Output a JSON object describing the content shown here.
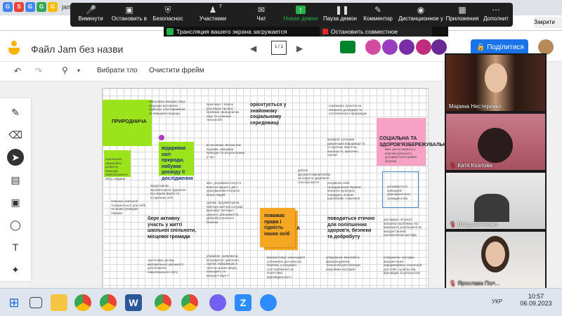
{
  "zoom_controls": {
    "mute": "Вимкнути",
    "stop_video": "Остановить в",
    "security": "Безопаснос",
    "participants": "Участники",
    "participants_count": "7",
    "chat": "Чат",
    "new_demo": "Новая демон",
    "pause_demo": "Пауза демон",
    "comment": "Комментир",
    "remote_control": "Дистанционное у",
    "apps": "Приложения",
    "more": "Дополнит"
  },
  "share_banner": {
    "text": "Трансляция вашего экрана загружается",
    "stop": "Остановить совместное использование"
  },
  "browser": {
    "tab_partial": "jam",
    "close_tab": "Закрити"
  },
  "app": {
    "title": "Файл Jam без назви",
    "page_indicator": "1 / 1",
    "share_button": "Поділитися"
  },
  "toolbar": {
    "select_background": "Вибрати тло",
    "clear_frame": "Очистити фрейм"
  },
  "canvas_notes": {
    "green1": "ПРИРОДНИЧА",
    "green2": "пояснюємо гармонійно розвитку природи, навколишнього світу, людини",
    "green3": "відкриває світ природи, набуває досвіду її дослідження",
    "pink": "СОЦІАЛЬНА ТА ЗДОРОВ'ЯЗБЕРЕЖУВАЛЬНА",
    "pink_small": "вміє застосовувати у власній діяльності, дотримується правил безпеки",
    "orange": "поважає права і гідність інших осіб",
    "orange_a": "А",
    "bold1": "орієнтується у знайомому соціальному середовищі",
    "bold2": "бере активну участь у житті шкільної спільноти, місцевої громади",
    "bold3": "поводиться етично для поліпшення здоров'я, безпеки та добробуту",
    "t1": "ефективно використовує природні матеріали, здійснює спостереження за явищами природи",
    "t2": "практикує і творчо розглядає процесі прийоми природничих наук та сучасних технологій",
    "t3": "спрямовує зусилля на пізнання, досліджує та систематизує інформацію",
    "t4": "встановлює зв'язки між подіями, явищами природи і їх результатами у часі",
    "t5": "правила з різними джерелами інформації та історичних пам'яток, аналізує їх, критично оцінює",
    "t6": "робить аргументований вибір на користь здорового способу життя",
    "t7": "представляє, аргументуючи судження про відомі факти та історичних осіб",
    "t8": "має, розуміючи почуття власної гідності, дія з урахуванням інтересів інших людей",
    "t9": "розуміння себе громадянином України, аналізує культурну спадщину, плекає шанобливе ставлення",
    "t10": "дотримується принципів демократичного громадянства",
    "t11": "пояснює значення толерантності для себе та інших громадян України",
    "t12": "оцінює, аргументуючи, пов'язує життєві ситуації, враховує погляди і цінності, різноманіття, добробуту власної безпеки",
    "t13": "досліджує ситуації і визначає проблеми, які вимагають розв'язання за використанням математичних методів",
    "t14": "застосовує досвід математичної діяльності для пізнання навколишнього світу",
    "t15": "управляє, заявляючи, інтерпретує, критично оцінює інформацію в текстах різних медіа, знаходить та використовує її",
    "t16": "використовує законодавчі положення для власної безпеки, у розумінні, спостереження за поняттями відповідальності",
    "t17": "усвідомлює важливість функціонування технологій для безпеки, шкідливих наслідків",
    "t18": "усвідомлює наслідки використання інформаційних технологій для себе, суспільства, відповідає за результати"
  },
  "participants": [
    {
      "name": "Марина Нестеренко",
      "muted": false
    },
    {
      "name": "Катя Козлова",
      "muted": true
    },
    {
      "name": "Влад Сенченко",
      "muted": true
    },
    {
      "name": "Ярослава Пол...",
      "muted": true
    }
  ],
  "taskbar": {
    "time": "10:57",
    "date": "06.09.2023",
    "lang": "УКР"
  },
  "colors": {
    "green": "#9be31a",
    "pink": "#f7a1c4",
    "orange": "#f5a623",
    "share_blue": "#1a73e8",
    "zoom_green": "#23b34a",
    "stop_red": "#e02828"
  }
}
